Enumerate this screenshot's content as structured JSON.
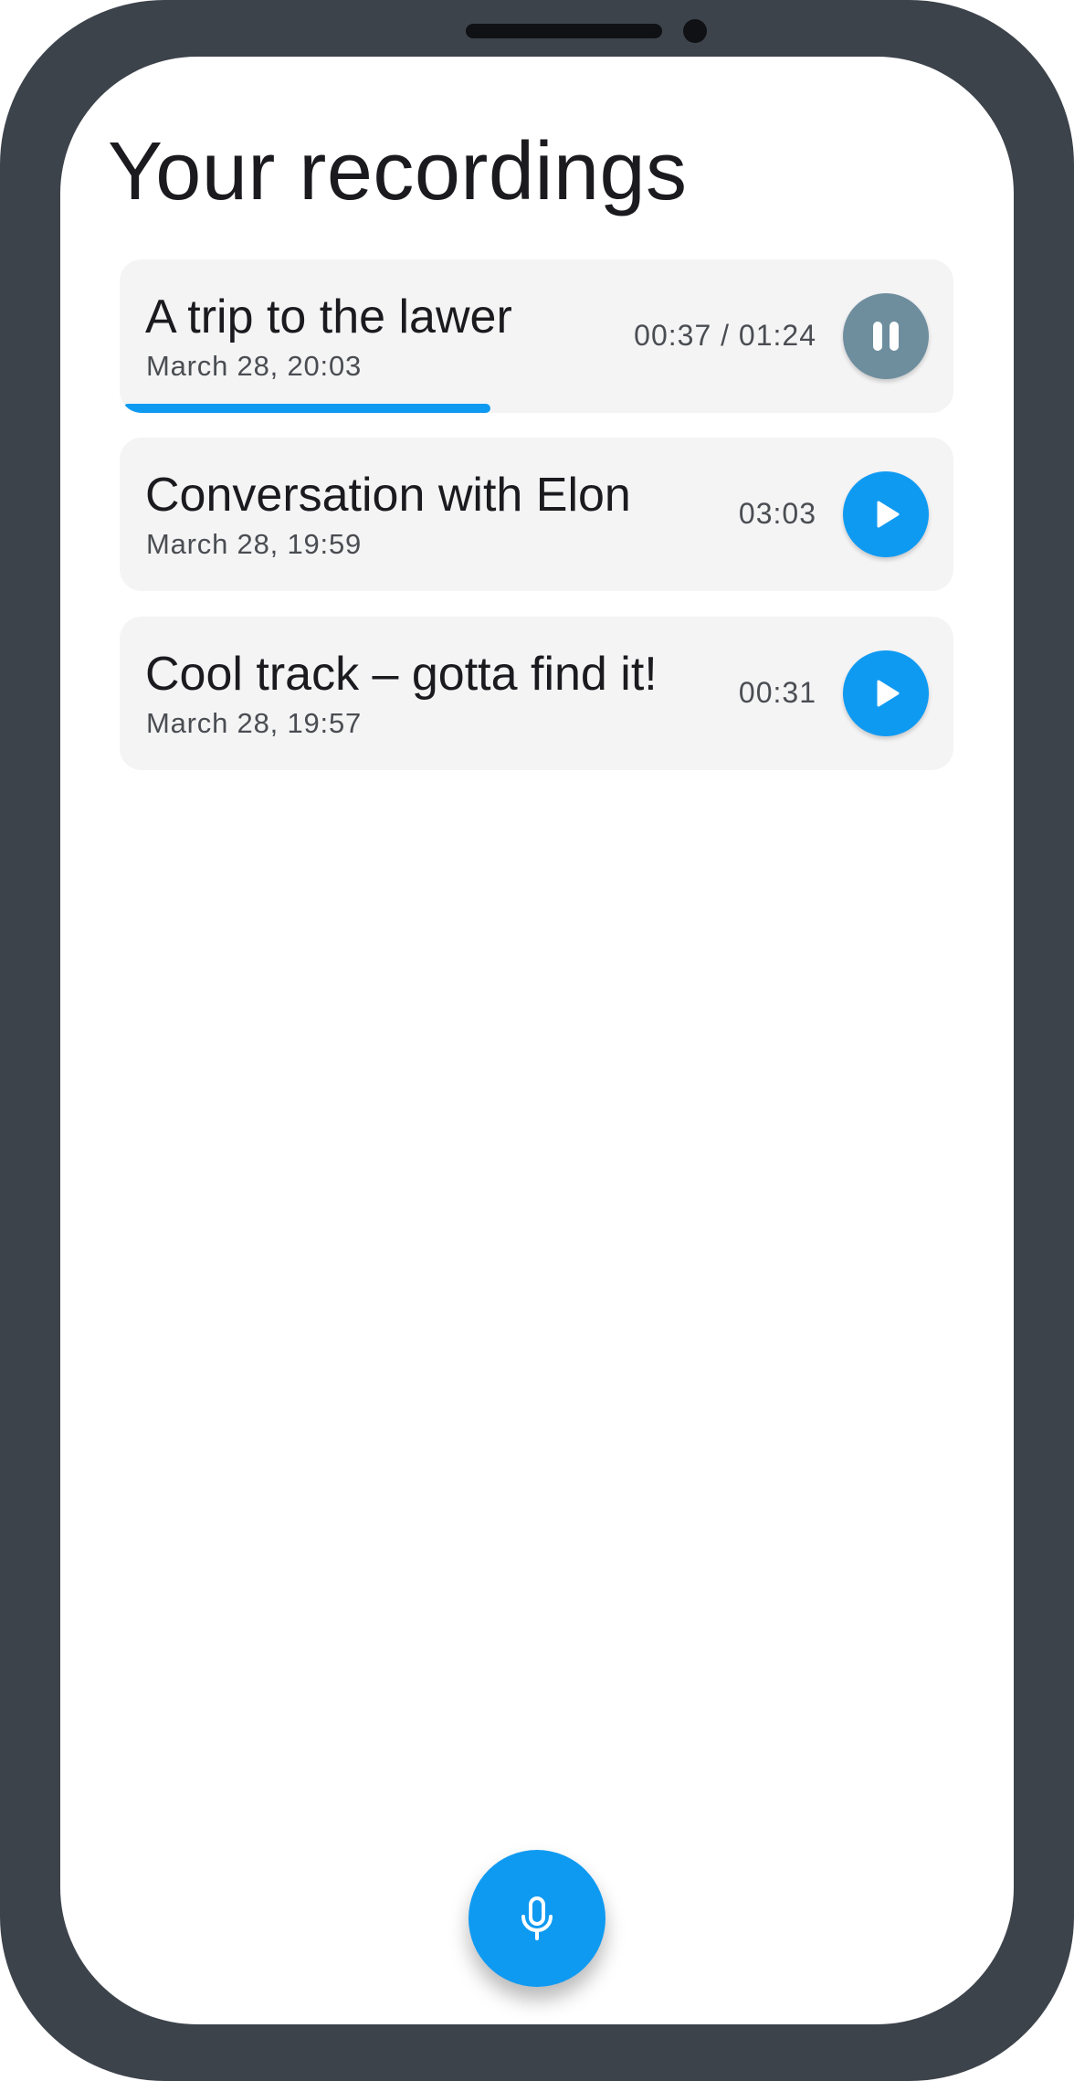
{
  "page": {
    "title": "Your recordings"
  },
  "recordings": [
    {
      "name": "A trip to the lawer",
      "date": "March 28, 20:03",
      "duration": "00:37 / 01:24",
      "state": "playing",
      "progress": 0.444,
      "button_icon": "pause-icon"
    },
    {
      "name": "Conversation with Elon",
      "date": "March 28, 19:59",
      "duration": "03:03",
      "state": "stopped",
      "button_icon": "play-icon"
    },
    {
      "name": "Cool track – gotta find it!",
      "date": "March 28, 19:57",
      "duration": "00:31",
      "state": "stopped",
      "button_icon": "play-icon"
    }
  ],
  "record_button": {
    "icon": "microphone-icon"
  },
  "colors": {
    "accent": "#0f9af2",
    "pause_button": "#6e8e9e",
    "card_background": "#f4f4f5",
    "device_frame": "#3d434b"
  }
}
